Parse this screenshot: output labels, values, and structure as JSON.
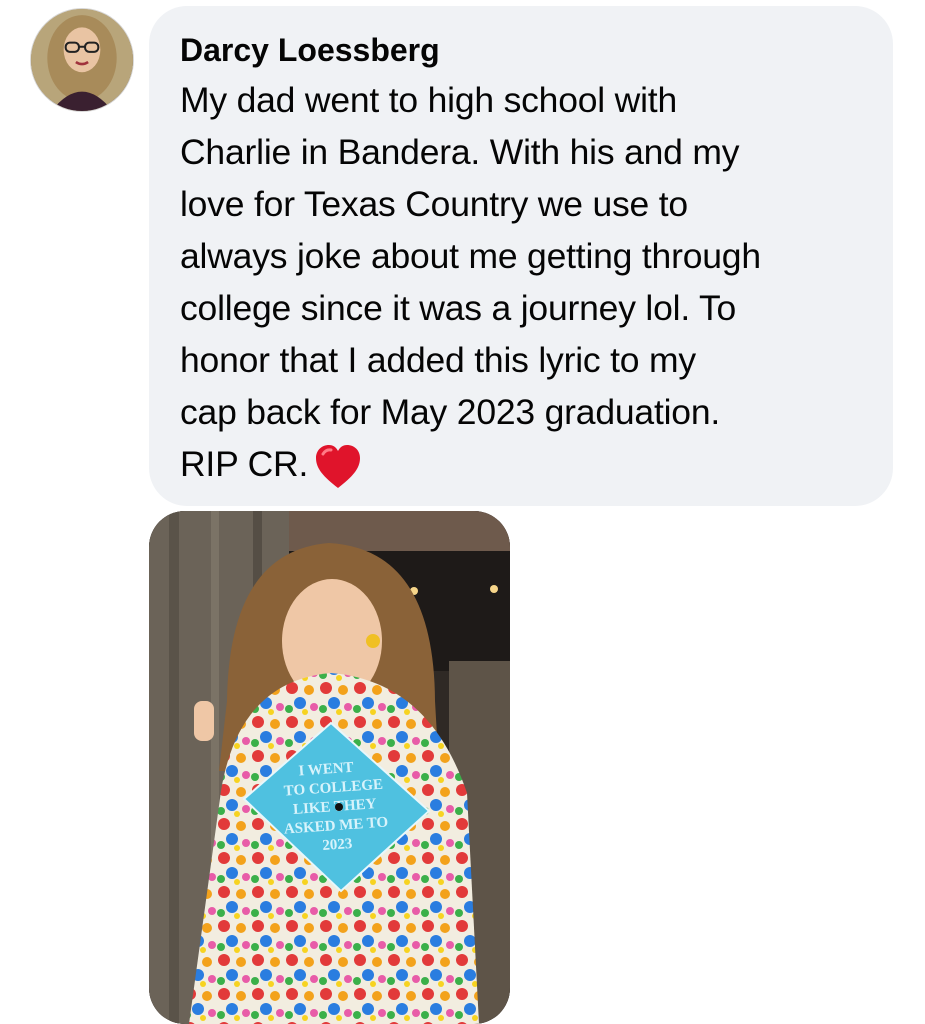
{
  "comment": {
    "author": "Darcy Loessberg",
    "text": "My dad went to high school with\nCharlie in Bandera. With his and my\nlove for Texas Country we use to\nalways joke about me getting through\ncollege since it was a journey lol. To\nhonor that I added this lyric to my\ncap back for May 2023 graduation.\nRIP CR.",
    "emoji": "heart-icon",
    "emoji_color": "#e0142b",
    "bubble_color": "#f0f2f5"
  },
  "photo": {
    "cap_text": [
      "I WENT",
      "TO COLLEGE",
      "LIKE THEY",
      "ASKED ME TO",
      "2023"
    ],
    "cap_color": "#4fc1e0"
  }
}
